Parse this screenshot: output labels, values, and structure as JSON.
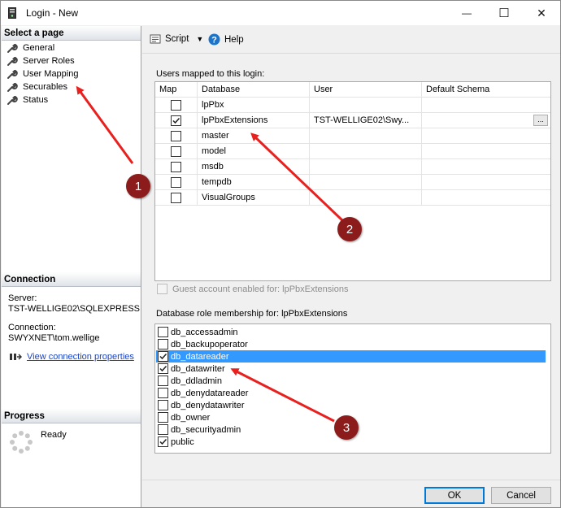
{
  "window": {
    "title": "Login - New",
    "minimize": "—",
    "maximize": "☐",
    "close": "✕"
  },
  "sidebar": {
    "select_page_header": "Select a page",
    "pages": [
      {
        "label": "General"
      },
      {
        "label": "Server Roles"
      },
      {
        "label": "User Mapping"
      },
      {
        "label": "Securables"
      },
      {
        "label": "Status"
      }
    ],
    "connection_header": "Connection",
    "server_label": "Server:",
    "server_value": "TST-WELLIGE02\\SQLEXPRESS",
    "connection_label": "Connection:",
    "connection_value": "SWYXNET\\tom.wellige",
    "view_props_link": "View connection properties",
    "progress_header": "Progress",
    "progress_status": "Ready"
  },
  "toolbar": {
    "script_label": "Script",
    "help_label": "Help"
  },
  "mapping": {
    "label": "Users mapped to this login:",
    "columns": [
      "Map",
      "Database",
      "User",
      "Default Schema"
    ],
    "rows": [
      {
        "checked": false,
        "database": "lpPbx",
        "user": "",
        "schema": ""
      },
      {
        "checked": true,
        "database": "lpPbxExtensions",
        "user": "TST-WELLIGE02\\Swy...",
        "schema": "",
        "ellipsis": "..."
      },
      {
        "checked": false,
        "database": "master",
        "user": "",
        "schema": ""
      },
      {
        "checked": false,
        "database": "model",
        "user": "",
        "schema": ""
      },
      {
        "checked": false,
        "database": "msdb",
        "user": "",
        "schema": ""
      },
      {
        "checked": false,
        "database": "tempdb",
        "user": "",
        "schema": ""
      },
      {
        "checked": false,
        "database": "VisualGroups",
        "user": "",
        "schema": ""
      }
    ],
    "guest_label": "Guest account enabled for: lpPbxExtensions"
  },
  "roles": {
    "label": "Database role membership for: lpPbxExtensions",
    "items": [
      {
        "name": "db_accessadmin",
        "checked": false,
        "selected": false
      },
      {
        "name": "db_backupoperator",
        "checked": false,
        "selected": false
      },
      {
        "name": "db_datareader",
        "checked": true,
        "selected": true
      },
      {
        "name": "db_datawriter",
        "checked": true,
        "selected": false
      },
      {
        "name": "db_ddladmin",
        "checked": false,
        "selected": false
      },
      {
        "name": "db_denydatareader",
        "checked": false,
        "selected": false
      },
      {
        "name": "db_denydatawriter",
        "checked": false,
        "selected": false
      },
      {
        "name": "db_owner",
        "checked": false,
        "selected": false
      },
      {
        "name": "db_securityadmin",
        "checked": false,
        "selected": false
      },
      {
        "name": "public",
        "checked": true,
        "selected": false
      }
    ]
  },
  "buttons": {
    "ok": "OK",
    "cancel": "Cancel"
  },
  "annotations": {
    "badge1": "1",
    "badge2": "2",
    "badge3": "3",
    "color": "#e8201e"
  }
}
